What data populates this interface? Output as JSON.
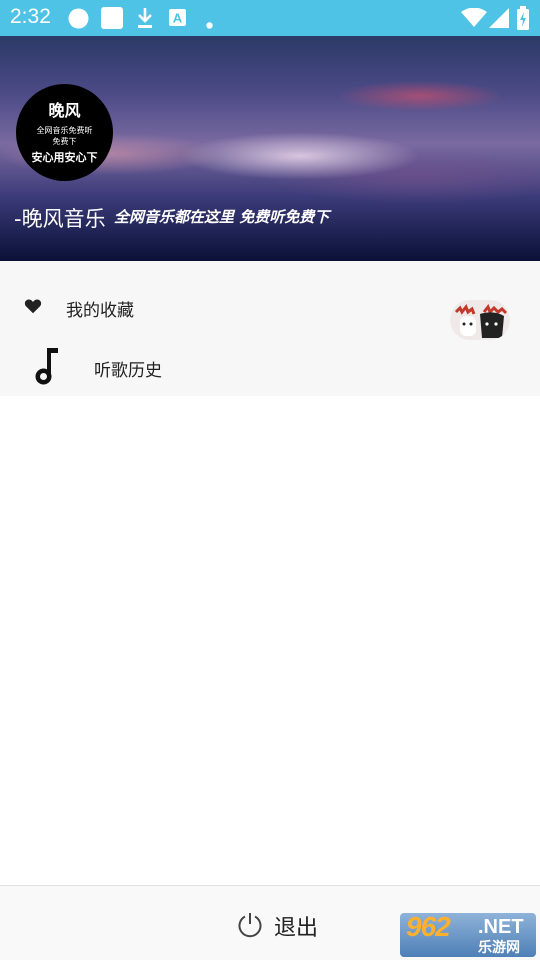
{
  "status_bar": {
    "time": "2:32",
    "icons": [
      "circle-icon",
      "square-icon",
      "download-icon",
      "translate-a-icon",
      "dot-icon",
      "wifi-icon",
      "signal-icon",
      "battery-charging-icon"
    ]
  },
  "header": {
    "avatar": {
      "title": "晚风",
      "line1": "全网音乐免费听",
      "line2": "免费下",
      "bottom": "安心用安心下"
    },
    "app_name": "-晚风音乐",
    "slogan": "全网音乐都在这里 免费听免费下"
  },
  "menu": {
    "items": [
      {
        "label": "我的收藏",
        "icon": "heart-icon"
      },
      {
        "label": "听歌历史",
        "icon": "music-note-icon"
      }
    ]
  },
  "bottom_bar": {
    "logout_label": "退出",
    "logout_icon": "power-icon"
  },
  "watermark": {
    "number": "962",
    "domain": ".NET",
    "sub": "乐游网"
  },
  "colors": {
    "status_bar": "#4fc3e6",
    "menu_bg": "#f7f7f7",
    "bottom_bg": "#f9f9f9"
  }
}
